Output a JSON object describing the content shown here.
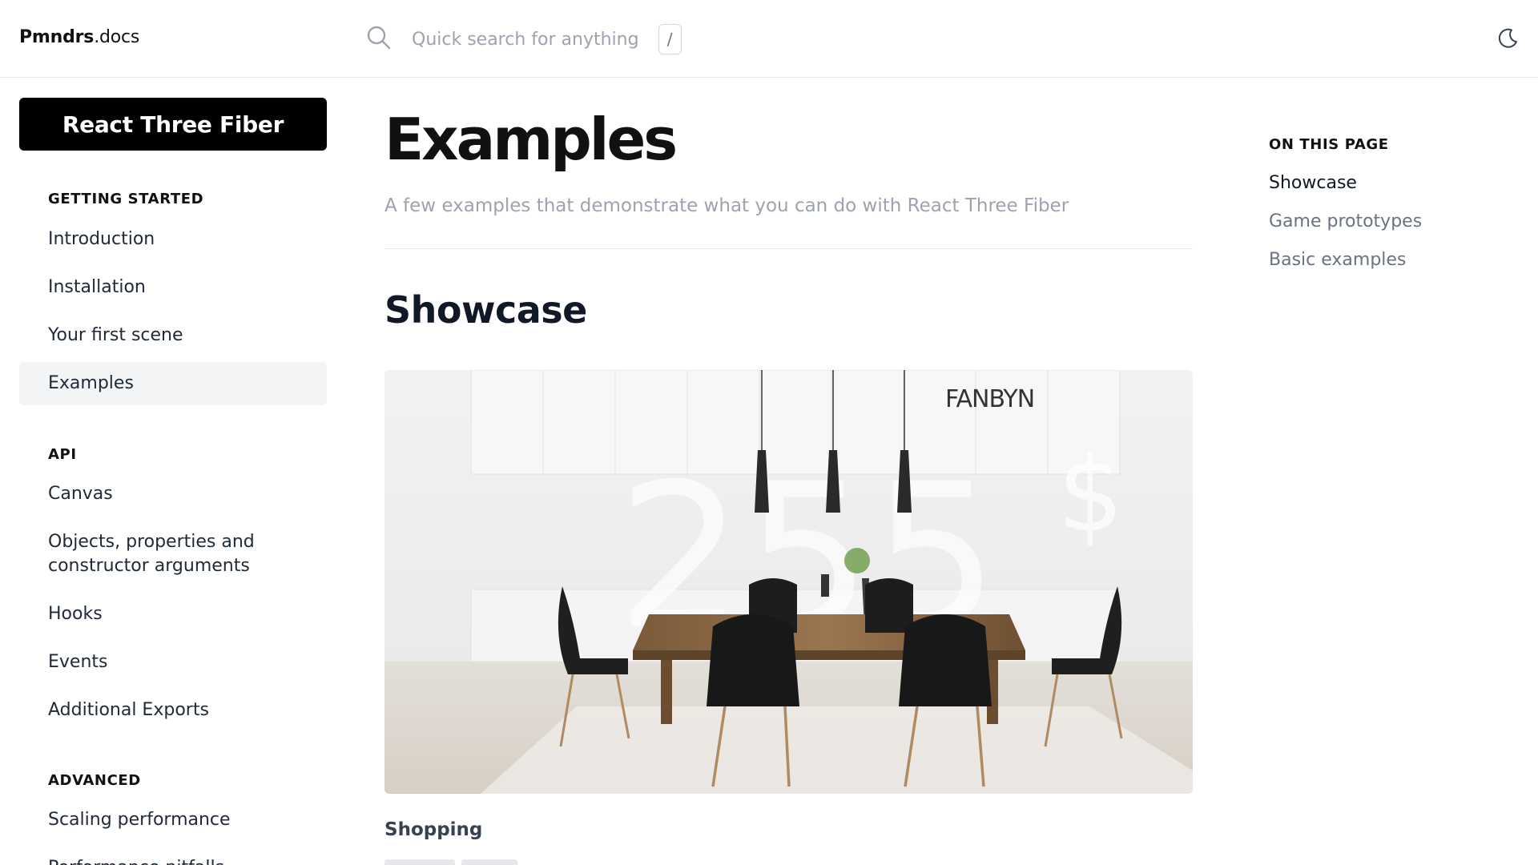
{
  "header": {
    "logo_bold": "Pmndrs",
    "logo_rest": ".docs",
    "search_placeholder": "Quick search for anything",
    "search_shortcut": "/",
    "theme_icon": "moon-icon"
  },
  "sidebar": {
    "brand_button": "React Three Fiber",
    "sections": [
      {
        "title": "GETTING STARTED",
        "items": [
          "Introduction",
          "Installation",
          "Your first scene",
          "Examples"
        ]
      },
      {
        "title": "API",
        "items": [
          "Canvas",
          "Objects, properties and constructor arguments",
          "Hooks",
          "Events",
          "Additional Exports"
        ]
      },
      {
        "title": "ADVANCED",
        "items": [
          "Scaling performance",
          "Performance pitfalls"
        ]
      }
    ],
    "active_item": "Examples"
  },
  "main": {
    "title": "Examples",
    "description": "A few examples that demonstrate what you can do with React Three Fiber",
    "section_heading": "Showcase",
    "showcase_image": {
      "brand_text": "FANBYN",
      "price_text": "255",
      "currency": "$"
    },
    "item_title": "Shopping"
  },
  "toc": {
    "title": "ON THIS PAGE",
    "items": [
      "Showcase",
      "Game prototypes",
      "Basic examples"
    ],
    "active": "Showcase"
  }
}
